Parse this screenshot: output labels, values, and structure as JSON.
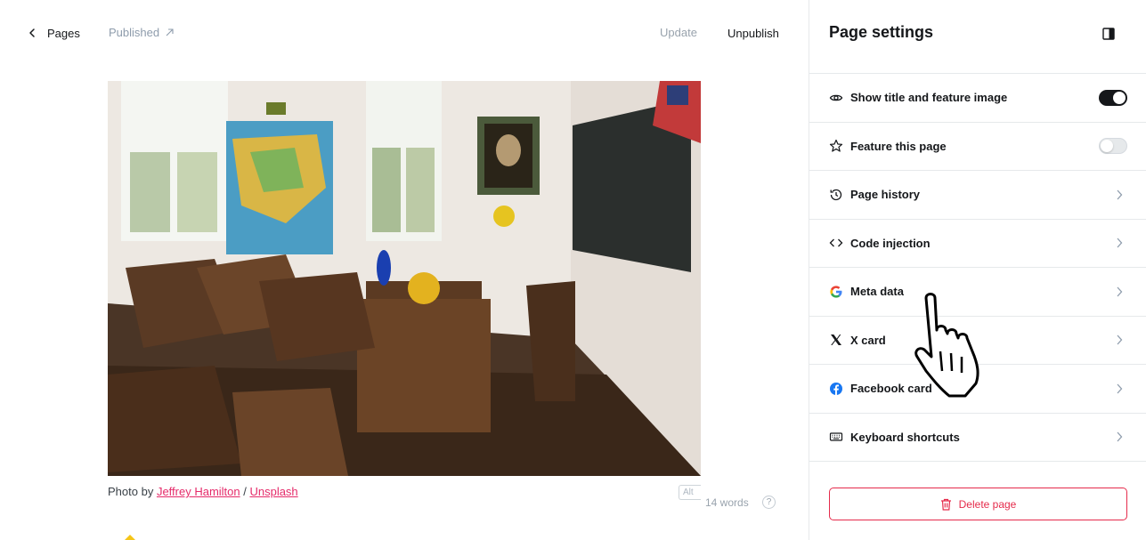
{
  "topbar": {
    "back_label": "Pages",
    "published_label": "Published",
    "update_label": "Update",
    "unpublish_label": "Unpublish"
  },
  "caption": {
    "prefix": "Photo by ",
    "author": "Jeffrey Hamilton",
    "separator": " / ",
    "source": "Unsplash"
  },
  "editor": {
    "alt_label": "Alt",
    "word_count": "14 words",
    "help_label": "?"
  },
  "panel": {
    "title": "Page settings",
    "rows": [
      {
        "label": "Show title and feature image",
        "icon": "eye-icon",
        "control": "toggle",
        "on": true
      },
      {
        "label": "Feature this page",
        "icon": "star-icon",
        "control": "toggle",
        "on": false
      },
      {
        "label": "Page history",
        "icon": "history-icon",
        "control": "chevron"
      },
      {
        "label": "Code injection",
        "icon": "code-icon",
        "control": "chevron"
      },
      {
        "label": "Meta data",
        "icon": "google-icon",
        "control": "chevron"
      },
      {
        "label": "X card",
        "icon": "x-logo-icon",
        "control": "chevron"
      },
      {
        "label": "Facebook card",
        "icon": "facebook-icon",
        "control": "chevron"
      },
      {
        "label": "Keyboard shortcuts",
        "icon": "keyboard-icon",
        "control": "chevron"
      }
    ],
    "delete_label": "Delete page"
  },
  "colors": {
    "accent_link": "#e52b6a",
    "danger": "#e52b4b",
    "toggle_on": "#15171a"
  }
}
